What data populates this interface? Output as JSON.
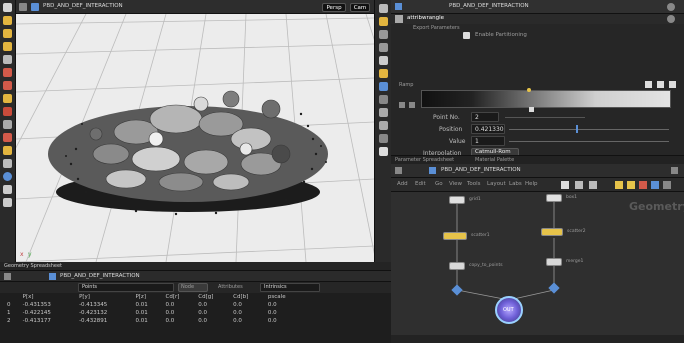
{
  "viewport": {
    "title": "PBD_AND_DEF_INTERACTION",
    "camera_label": "Persp",
    "display_label": "Cam"
  },
  "params": {
    "header_title": "PBD_AND_DEF_INTERACTION",
    "node_name": "attribwrangle",
    "section_label": "Export Parameters",
    "checkbox_label": "Enable Partitioning",
    "ramp_label": "Ramp",
    "fields": [
      {
        "label": "Point No.",
        "value": "2"
      },
      {
        "label": "Position",
        "value": "0.421330"
      },
      {
        "label": "Value",
        "value": "1"
      },
      {
        "label": "Interpolation",
        "value": "Catmull-Rom"
      }
    ]
  },
  "pane_tabs": [
    "Parameter Spreadsheet",
    "Material Palette"
  ],
  "network": {
    "path": "PBD_AND_DEF_INTERACTION",
    "menu": [
      "Add",
      "Edit",
      "Go",
      "View",
      "Tools",
      "Layout",
      "Labs",
      "Help"
    ],
    "watermark": "Geometry",
    "node_labels": {
      "top_left": "grid1",
      "top_right": "box1",
      "mid_left": "scatter1",
      "mid_right": "scatter2",
      "low_left": "copy_to_points",
      "low_right": "merge1",
      "output": "OUT"
    }
  },
  "spreadsheet": {
    "tabs": "Geometry Spreadsheet",
    "path": "PBD_AND_DEF_INTERACTION",
    "filter_node": "Points",
    "filter_view": "Node",
    "filter_a": "Attributes",
    "filter_b": "Intrinsics",
    "headers": [
      "",
      "P[x]",
      "P[y]",
      "P[z]",
      "Cd[r]",
      "Cd[g]",
      "Cd[b]",
      "pscale"
    ],
    "rows": [
      [
        "0",
        "-0.431353",
        "-0.413345",
        "0.01",
        "0.0",
        "0.0",
        "0.0",
        "0.0"
      ],
      [
        "1",
        "-0.422145",
        "-0.423132",
        "0.01",
        "0.0",
        "0.0",
        "0.0",
        "0.0"
      ],
      [
        "2",
        "-0.413177",
        "-0.432891",
        "0.01",
        "0.0",
        "0.0",
        "0.0",
        "0.0"
      ]
    ]
  },
  "colors": {
    "accent_yellow": "#e6c34a",
    "accent_blue": "#5a8fd6",
    "viewport_bg": "#ececec"
  }
}
